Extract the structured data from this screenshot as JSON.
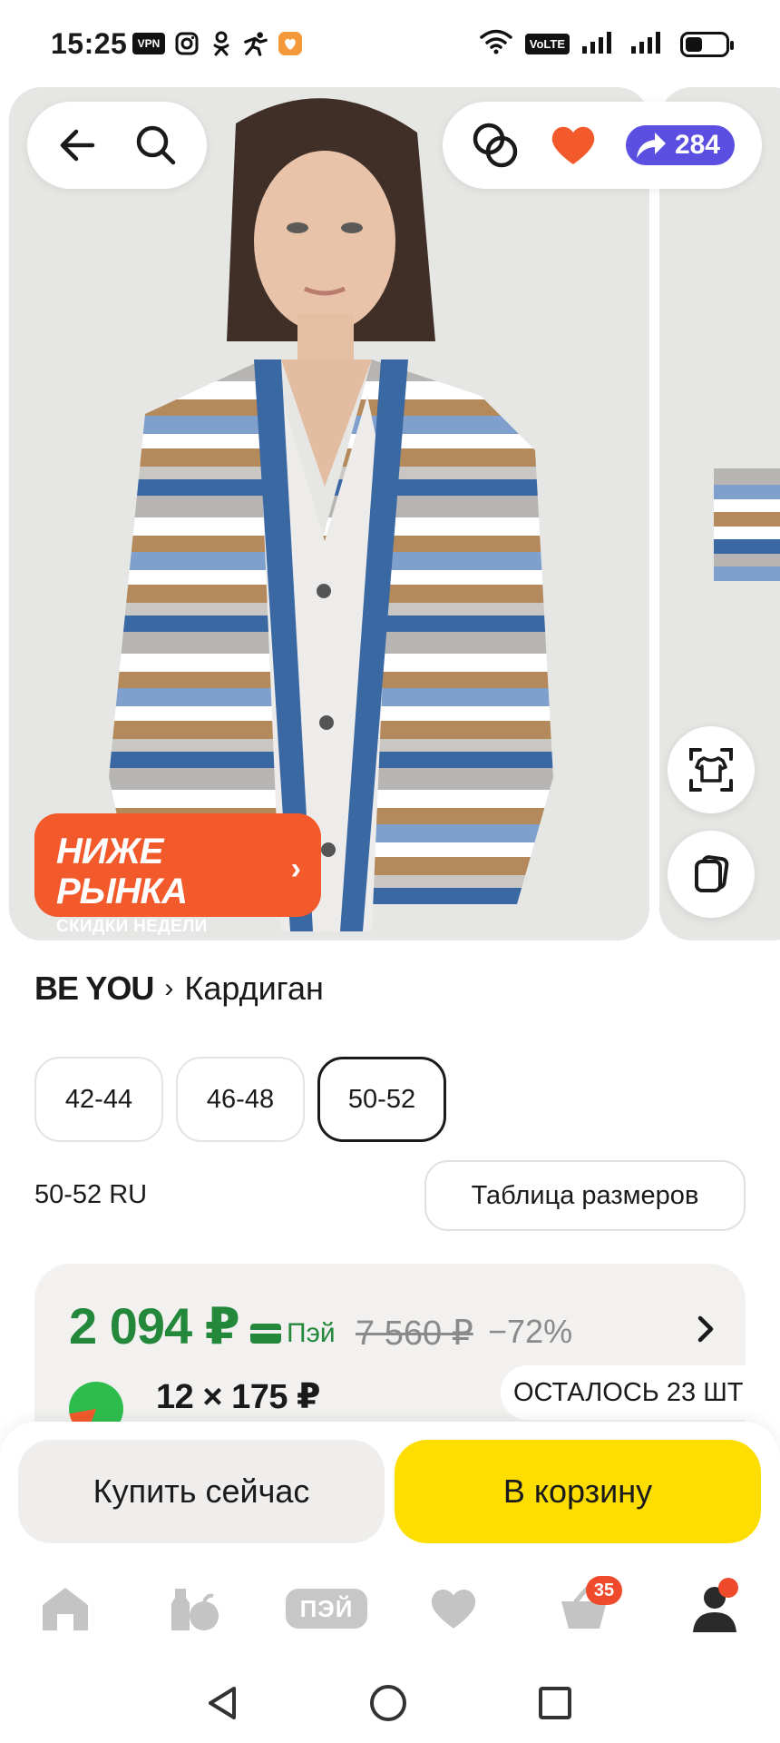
{
  "status_bar": {
    "time": "15:25",
    "vpn_label": "VPN",
    "volte_label": "VoLTE",
    "icons": [
      "instagram-icon",
      "odnoklassniki-icon",
      "activity-icon",
      "app-notification-icon",
      "wifi-icon",
      "signal-icon",
      "battery-icon"
    ]
  },
  "top_bar": {
    "back_icon": "back-arrow-icon",
    "search_icon": "search-icon",
    "compare_icon": "compare-rings-icon",
    "favorite_icon": "heart-icon",
    "share_count": "284"
  },
  "promo": {
    "title": "НИЖЕ РЫНКА",
    "subtitle": "СКИДКИ НЕДЕЛИ",
    "chevron": "›"
  },
  "product": {
    "brand": "BE YOU",
    "separator": "›",
    "name": "Кардиган"
  },
  "sizes": {
    "options": [
      "42-44",
      "46-48",
      "50-52"
    ],
    "selected": "50-52",
    "note": "50-52 RU",
    "table_button": "Таблица размеров"
  },
  "price": {
    "current": "2 094 ₽",
    "pay_label": "Пэй",
    "old": "7 560 ₽",
    "discount": "−72%",
    "installment": "12 × 175 ₽",
    "stock": "ОСТАЛОСЬ 23 ШТ"
  },
  "actions": {
    "buy_now": "Купить сейчас",
    "add_to_cart": "В корзину"
  },
  "tabbar": {
    "pay_label": "ПЭЙ",
    "cart_count": "35"
  },
  "colors": {
    "price_green": "#24883b",
    "promo_orange": "#f25a2c",
    "cart_yellow": "#fedd00",
    "share_purple": "#5a4fe0",
    "badge_red": "#f04a2d"
  }
}
